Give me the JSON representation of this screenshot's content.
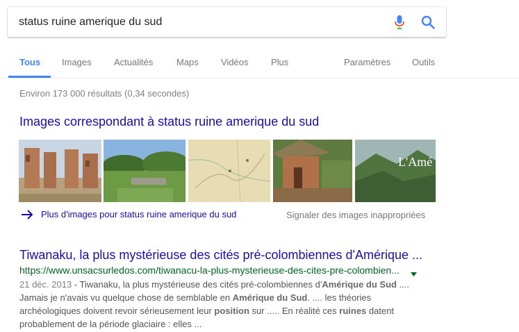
{
  "search": {
    "query": "status ruine amerique du sud",
    "mic_icon": "microphone-icon",
    "search_icon": "magnifier-icon"
  },
  "tabs": [
    {
      "label": "Tous",
      "active": true
    },
    {
      "label": "Images"
    },
    {
      "label": "Actualités"
    },
    {
      "label": "Maps"
    },
    {
      "label": "Vidéos"
    },
    {
      "label": "Plus"
    }
  ],
  "tools": {
    "settings_label": "Paramètres",
    "tools_label": "Outils"
  },
  "stats": "Environ 173 000 résultats (0,34 secondes)",
  "images_block": {
    "heading": "Images correspondant à status ruine amerique du sud",
    "more_label": "Plus d'images pour status ruine amerique du sud",
    "report_label": "Signaler des images inappropriées",
    "thumb5_text": "L'Amé"
  },
  "result": {
    "title": "Tiwanaku, la plus mystérieuse des cités pré-colombiennes d'Amérique ...",
    "url": "https://www.unsacsurledos.com/tiwanacu-la-plus-mysterieuse-des-cites-pre-colombien...",
    "date": "21 déc. 2013",
    "s1": " - Tiwanaku, la plus mystérieuse des cités pré-colombiennes d'",
    "b1": "Amérique du Sud",
    "s2": " .... Jamais je n'avais vu quelque chose de semblable en ",
    "b2": "Amérique du Sud",
    "s3": ". .... les théories archéologiques doivent revoir sérieusement leur ",
    "b3": "position",
    "s4": " sur ..... En réalité ces ",
    "b4": "ruines",
    "s5": " datent probablement de la période glaciaire : elles ..."
  },
  "colors": {
    "link": "#1a0dab",
    "url": "#006621",
    "accent": "#4285f4",
    "text_muted": "#545454"
  }
}
